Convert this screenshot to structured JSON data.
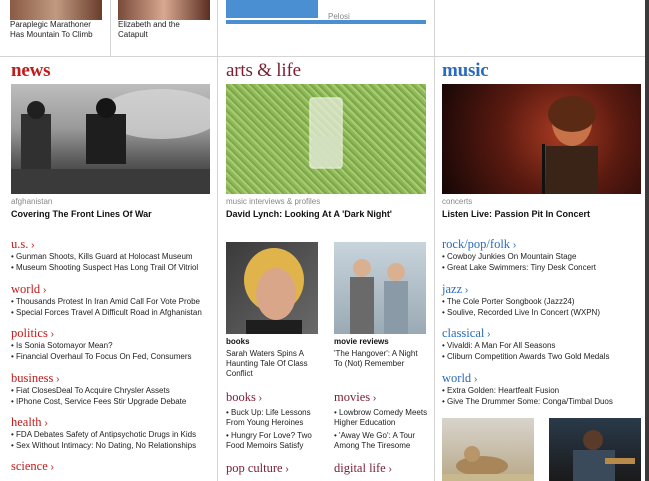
{
  "top": {
    "story1": "Paraplegic Marathoner Has Mountain To Climb",
    "story2": "Elizabeth and the Catapult",
    "story3_gray": "Pelosi"
  },
  "news": {
    "title": "news",
    "kicker": "afghanistan",
    "headline": "Covering The Front Lines Of War",
    "sections": [
      {
        "label": "u.s.",
        "items": [
          "Gunman Shoots, Kills Guard at Holocast Museum",
          "Museum Shooting Suspect Has Long Trail Of Vitriol"
        ]
      },
      {
        "label": "world",
        "items": [
          "Thousands Protest In Iran Amid Call For Vote Probe",
          "Special Forces Travel A Difficult Road in Afghanistan"
        ]
      },
      {
        "label": "politics",
        "items": [
          "Is Sonia Sotomayor Mean?",
          "Financial Overhaul To Focus On Fed, Consumers"
        ]
      },
      {
        "label": "business",
        "items": [
          "Fiat ClosesDeal To Acquire Chrysler Assets",
          "IPhone Cost, Service Fees Stir Upgrade Debate"
        ]
      },
      {
        "label": "health",
        "items": [
          "FDA Debates Safety of Antipsychotic Drugs in Kids",
          "Sex Without Intimacy: No Dating, No Relationships"
        ]
      },
      {
        "label": "science",
        "items": []
      }
    ]
  },
  "arts": {
    "title": "arts & life",
    "kicker": "music interviews & profiles",
    "headline": "David Lynch: Looking At A 'Dark Night'",
    "feature_left": {
      "label": "books",
      "desc": "Sarah Waters Spins A Haunting Tale Of Class Conflict"
    },
    "feature_right": {
      "label": "movie reviews",
      "desc": "'The Hangover': A Night To (Not) Remember"
    },
    "books": {
      "label": "books",
      "items": [
        "Buck Up: Life Lessons From Young Heroines",
        "Hungry For Love? Two Food Memoirs Satisfy"
      ]
    },
    "movies": {
      "label": "movies",
      "items": [
        "Lowbrow Comedy Meets Higher Education",
        "'Away We Go': A Tour Among The Tiresome"
      ]
    },
    "pop_culture": "pop culture",
    "digital_life": "digital life"
  },
  "music": {
    "title": "music",
    "kicker": "concerts",
    "headline": "Listen Live: Passion Pit In Concert",
    "sections": [
      {
        "label": "rock/pop/folk",
        "items": [
          "Cowboy Junkies On Mountain Stage",
          "Great Lake Swimmers: Tiny Desk Concert"
        ]
      },
      {
        "label": "jazz",
        "items": [
          "The Cole Porter Songbook (Jazz24)",
          "Soulive, Recorded Live In Concert (WXPN)"
        ]
      },
      {
        "label": "classical",
        "items": [
          "Vivaldi: A Man For All Seasons",
          "Cliburn Competition Awards Two Gold Medals"
        ]
      },
      {
        "label": "world",
        "items": [
          "Extra Golden: Heartfealt Fusion",
          "Give The Drummer Some: Conga/Timbal Duos"
        ]
      }
    ]
  },
  "colors": {
    "news": "#c41a1a",
    "arts": "#7a1e32",
    "music": "#2a6bbf"
  }
}
